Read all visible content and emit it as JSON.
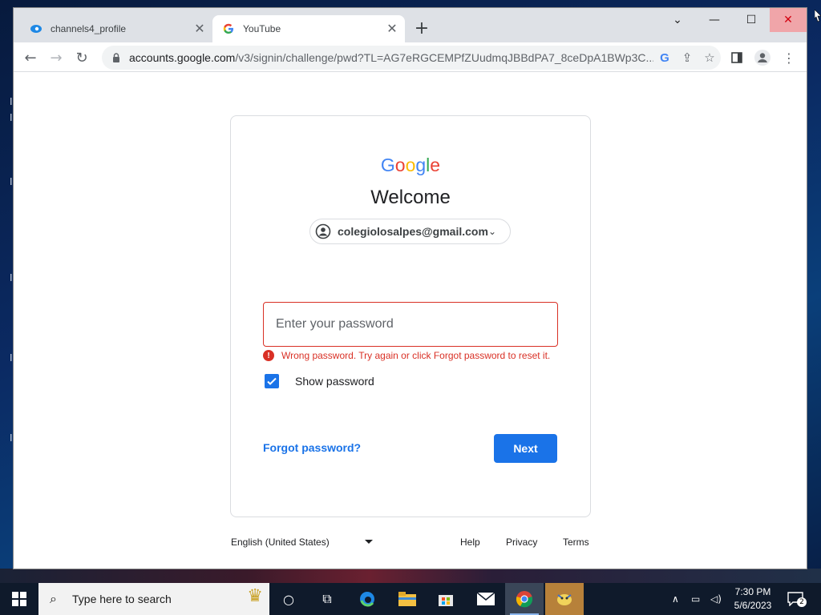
{
  "browser": {
    "tabs": [
      {
        "label": "channels4_profile",
        "active": false
      },
      {
        "label": "YouTube",
        "active": true
      }
    ],
    "new_tab_label": "+",
    "url_host": "accounts.google.com",
    "url_path": "/v3/signin/challenge/pwd?TL=AG7eRGCEMPfZUudmqJBBdPA7_8ceDpA1BWp3C..."
  },
  "signin": {
    "logo_letters": [
      "G",
      "o",
      "o",
      "g",
      "l",
      "e"
    ],
    "logo_colors": [
      "#4285F4",
      "#EA4335",
      "#FBBC05",
      "#4285F4",
      "#34A853",
      "#EA4335"
    ],
    "heading": "Welcome",
    "account_email": "colegiolosalpes@gmail.com",
    "password_placeholder": "Enter your password",
    "error_message": "Wrong password. Try again or click Forgot password to reset it.",
    "show_password_label": "Show password",
    "show_password_checked": true,
    "forgot_password_label": "Forgot password?",
    "next_label": "Next"
  },
  "footer": {
    "language": "English (United States)",
    "help": "Help",
    "privacy": "Privacy",
    "terms": "Terms"
  },
  "taskbar": {
    "search_placeholder": "Type here to search",
    "time": "7:30 PM",
    "date": "5/6/2023",
    "notification_count": "2"
  },
  "colors": {
    "accent": "#1a73e8",
    "error": "#d93025"
  }
}
